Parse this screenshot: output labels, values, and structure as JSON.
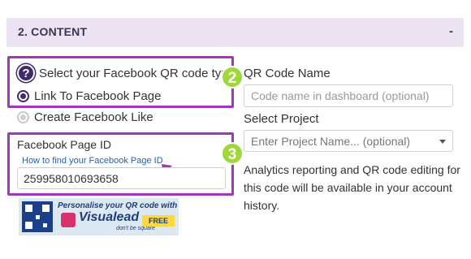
{
  "section": {
    "title": "2. CONTENT",
    "toggle": "-"
  },
  "qr_type": {
    "help_icon": "question-circle-icon",
    "label": "Select your Facebook QR code type:",
    "options": [
      {
        "label": "Link To Facebook Page",
        "selected": true
      },
      {
        "label": "Create Facebook Like",
        "selected": false
      }
    ],
    "step": "2"
  },
  "page_id": {
    "label": "Facebook Page ID",
    "help_link": "How to find your Facebook Page ID",
    "value": "259958010693658",
    "step": "3",
    "pointer_icon": "arrow-pointer-icon"
  },
  "promo": {
    "text": "Personalise your QR code with",
    "brand": "Visualead",
    "tagline": "don't be square",
    "badge": "FREE"
  },
  "qr_name": {
    "label": "QR Code Name",
    "placeholder": "Code name in dashboard (optional)"
  },
  "project": {
    "label": "Select Project",
    "placeholder": "Enter Project Name... (optional)"
  },
  "note": "Analytics reporting and QR code editing for this code will be available in your account history.",
  "colors": {
    "accent": "#a238b8",
    "header_bg": "#ece4f3",
    "badge": "#9fd83a",
    "link": "#1f5fbf"
  }
}
